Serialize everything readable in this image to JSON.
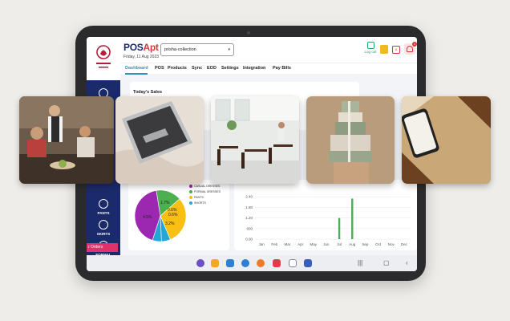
{
  "header": {
    "title_main": "POS",
    "title_accent": "Apt",
    "date": "Friday, 11 Aug 2023",
    "store_select": "prisha-collection",
    "logout_label": "Log out",
    "calendar_day": "8",
    "notifications_count": "1"
  },
  "nav": {
    "tabs": [
      "Dashboard",
      "POS",
      "Products",
      "Sync",
      "EOD",
      "Settings",
      "Integration",
      "Pay Bills"
    ]
  },
  "sidebar": {
    "items": [
      "PANTS",
      "SKIRTS",
      "FORMAL"
    ],
    "orders_label": "r Orders"
  },
  "dashboard": {
    "today_sales_title": "Today's Sales",
    "partial_digits": "i\n8"
  },
  "pie_chart": {
    "legend": [
      {
        "label": "CASUAL DRESSES",
        "color": "#9c27b0"
      },
      {
        "label": "FORMAL DRESSES",
        "color": "#4caf50"
      },
      {
        "label": "PANTS",
        "color": "#f9c013"
      },
      {
        "label": "SHORTS",
        "color": "#22a7d8"
      }
    ],
    "slice_labels": [
      "4.5%",
      "1.7%",
      "3.2%",
      "0.6%",
      "0.6%"
    ]
  },
  "chart_data": {
    "type": "bar",
    "categories": [
      "Jan",
      "Feb",
      "Mar",
      "Apr",
      "May",
      "Jun",
      "Jul",
      "Aug",
      "Sep",
      "Oct",
      "Nov",
      "Dec"
    ],
    "values": [
      0,
      0,
      0,
      0,
      0,
      0,
      1.2,
      2.3,
      0,
      0,
      0,
      0
    ],
    "ytick_labels": [
      "0.00",
      "600",
      "1.20",
      "1.80",
      "2.40"
    ],
    "ylim": [
      0,
      3
    ],
    "bar_color": "#4caf50"
  },
  "colors": {
    "brand_navy": "#1b2a6b",
    "accent_red": "#d23a3a",
    "active_tab": "#2f8fbd"
  },
  "dock": {
    "icons": [
      "gallery-icon",
      "files-icon",
      "calendar-app-icon",
      "messages-icon",
      "contacts-icon",
      "camera-icon",
      "chat-icon",
      "pos-app-icon"
    ]
  }
}
